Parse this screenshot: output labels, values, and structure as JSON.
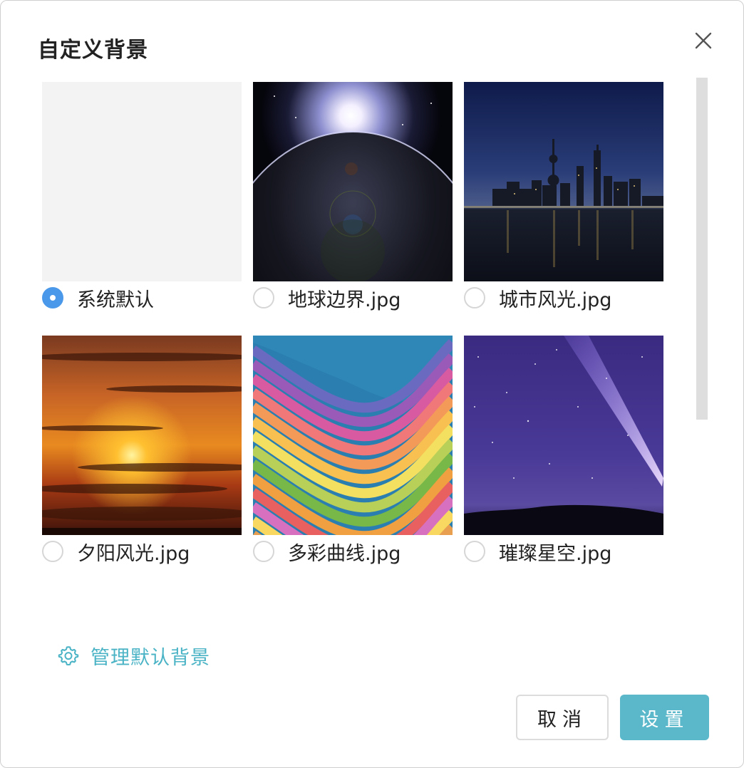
{
  "dialog": {
    "title": "自定义背景"
  },
  "backgrounds": [
    {
      "label": "系统默认",
      "selected": true,
      "thumbnail": "plain-light-gray"
    },
    {
      "label": "地球边界.jpg",
      "selected": false,
      "thumbnail": "planet-horizon-sunrise"
    },
    {
      "label": "城市风光.jpg",
      "selected": false,
      "thumbnail": "city-skyline-night"
    },
    {
      "label": "夕阳风光.jpg",
      "selected": false,
      "thumbnail": "orange-sunset"
    },
    {
      "label": "多彩曲线.jpg",
      "selected": false,
      "thumbnail": "rainbow-waves"
    },
    {
      "label": "璀璨星空.jpg",
      "selected": false,
      "thumbnail": "purple-starry-sky"
    }
  ],
  "manage": {
    "label": "管理默认背景",
    "icon": "gear-icon"
  },
  "buttons": {
    "cancel": "取消",
    "ok": "设置"
  },
  "colors": {
    "accent": "#5bb8ca",
    "link": "#4ab3c5",
    "radio_selected": "#4a98ea"
  }
}
